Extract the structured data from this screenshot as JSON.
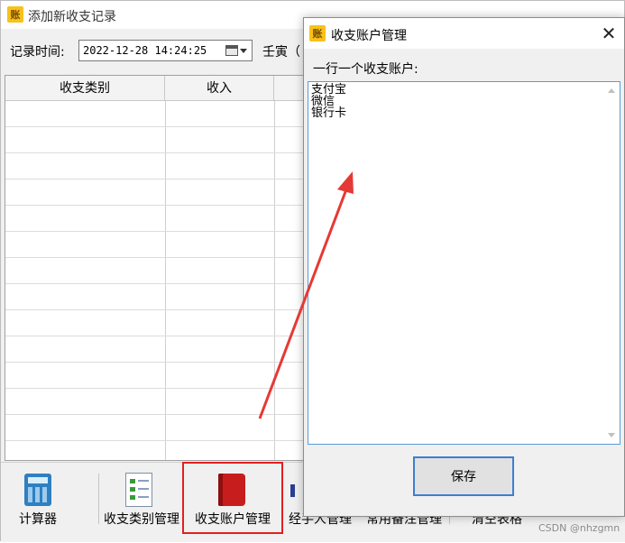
{
  "main_window": {
    "title": "添加新收支记录",
    "app_icon_glyph": "账",
    "record_time_label": "记录时间:",
    "date_value": "2022-12-28 14:24:25",
    "lunar_text": "壬寅（"
  },
  "grid": {
    "columns": [
      "收支类别",
      "收入"
    ]
  },
  "toolbar": {
    "items": [
      {
        "label": "计算器",
        "icon": "calculator-icon"
      },
      {
        "label": "收支类别管理",
        "icon": "category-list-icon"
      },
      {
        "label": "收支账户管理",
        "icon": "book-icon"
      },
      {
        "label": "经手人管理",
        "icon": "handler-icon"
      },
      {
        "label": "常用备注管理",
        "icon": "notes-icon"
      },
      {
        "label": "清空表格",
        "icon": "clear-icon"
      }
    ]
  },
  "dialog": {
    "title": "收支账户管理",
    "app_icon_glyph": "账",
    "accounts_label": "一行一个收支账户:",
    "accounts": [
      "支付宝",
      "微信",
      "银行卡"
    ],
    "save_label": "保存"
  },
  "watermark": "CSDN @nhzgmn",
  "colors": {
    "highlight": "#e21f1f",
    "dialog_focus": "#3c7fd0",
    "app_icon": "#f6c21b"
  }
}
